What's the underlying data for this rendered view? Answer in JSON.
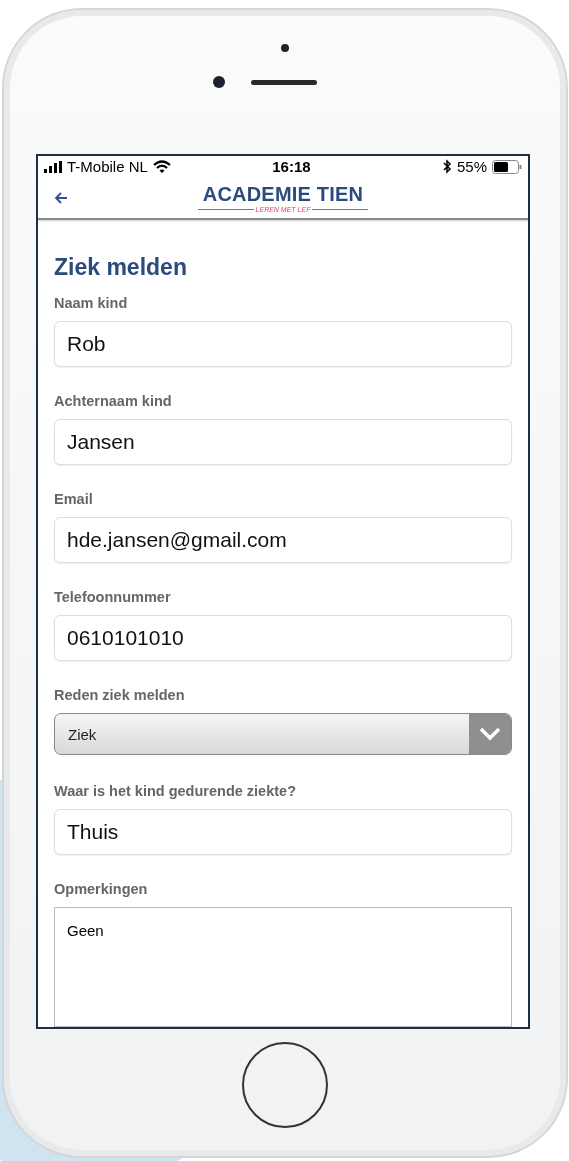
{
  "status_bar": {
    "carrier": "T-Mobile NL",
    "time": "16:18",
    "battery": "55%"
  },
  "header": {
    "logo_title": "ACADEMIE TIEN",
    "logo_tagline": "LEREN MET LEF"
  },
  "form": {
    "title": "Ziek melden",
    "fields": [
      {
        "kind": "text",
        "label": "Naam kind",
        "value": "Rob"
      },
      {
        "kind": "text",
        "label": "Achternaam kind",
        "value": "Jansen"
      },
      {
        "kind": "text",
        "label": "Email",
        "value": "hde.jansen@gmail.com"
      },
      {
        "kind": "text",
        "label": "Telefoonnummer",
        "value": "0610101010"
      },
      {
        "kind": "select",
        "label": "Reden ziek melden",
        "value": "Ziek"
      },
      {
        "kind": "text",
        "label": "Waar is het kind gedurende ziekte?",
        "value": "Thuis"
      },
      {
        "kind": "textarea",
        "label": "Opmerkingen",
        "value": "Geen"
      }
    ]
  }
}
